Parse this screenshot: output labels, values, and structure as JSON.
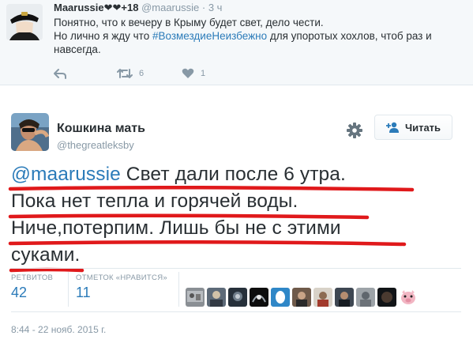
{
  "top_tweet": {
    "display_name": "Maarussie",
    "name_suffix": "❤❤+18",
    "handle": "@maarussie",
    "time_sep": "·",
    "time": "3 ч",
    "line1": "Понятно, что к вечеру в Крыму будет свет, дело чести.",
    "line2_pre": "Но лично я жду что ",
    "hashtag": "#ВозмездиеНеизбежно",
    "line2_post": " для упоротых хохлов, чтоб раз и",
    "line3": "навсегда.",
    "retweet_count": "6",
    "like_count": "1"
  },
  "main_tweet": {
    "display_name": "Кошкина мать",
    "handle": "@thegreatleksby",
    "follow_label": "Читать",
    "mention": "@maarussie",
    "line1_rest": " Свет дали после 6 утра.",
    "line2": "Пока нет тепла и горячей воды.",
    "line3": "Ниче,потерпим. Лишь бы не с этими",
    "line4": "суками.",
    "retweets_label": "РЕТВИТОВ",
    "retweets_count": "42",
    "likes_label": "ОТМЕТОК «НРАВИТСЯ»",
    "likes_count": "11",
    "timestamp": "8:44 - 22 нояб. 2015 г."
  },
  "colors": {
    "link": "#2b7bb9",
    "underline": "#e0191b",
    "muted": "#8899a6",
    "text": "#292f33"
  },
  "icons": [
    "reply-icon",
    "retweet-icon",
    "like-icon",
    "gear-icon",
    "follow-person-icon"
  ]
}
